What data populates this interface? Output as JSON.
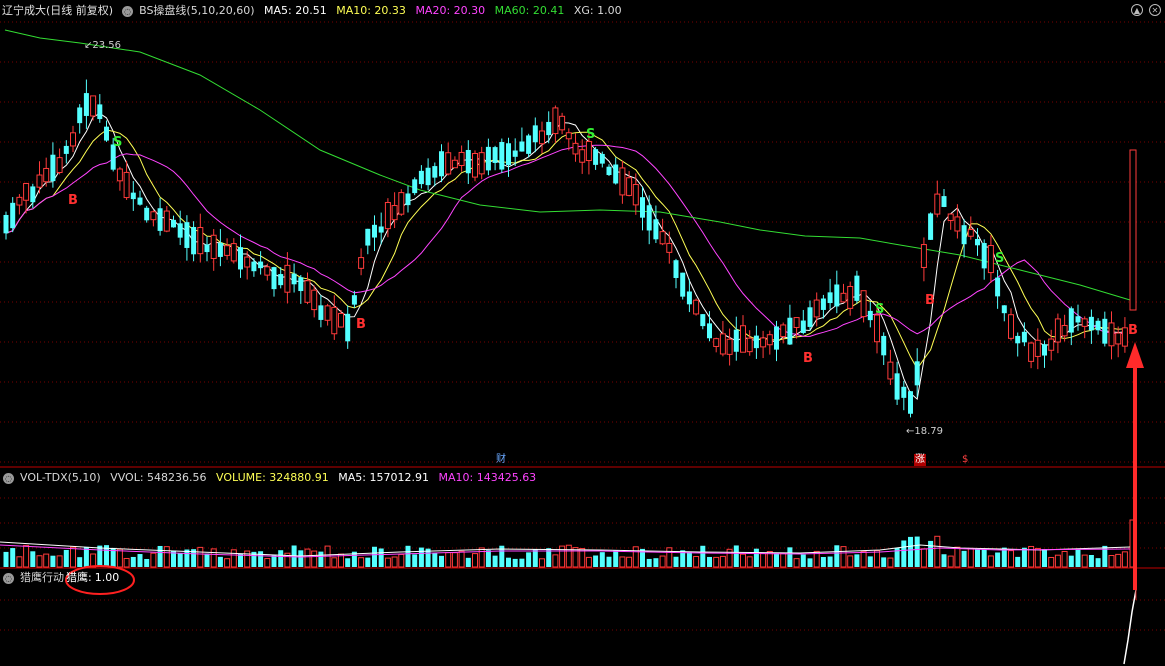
{
  "header_main": {
    "stock": "辽宁成大(日线 前复权)",
    "indicator": "BS操盘线(5,10,20,60)",
    "ma5": "MA5: 20.51",
    "ma10": "MA10: 20.33",
    "ma20": "MA20: 20.30",
    "ma60": "MA60: 20.41",
    "xg": "XG: 1.00"
  },
  "header_vol": {
    "name": "VOL-TDX(5,10)",
    "vvol": "VVOL: 548236.56",
    "volume": "VOLUME: 324880.91",
    "ma5": "MA5: 157012.91",
    "ma10": "MA10: 143425.63"
  },
  "header_hawk": {
    "name": "猎鹰行动",
    "value_label": "猎鹰:",
    "value": "1.00"
  },
  "labels": {
    "high": "23.56",
    "low": "18.79",
    "cai": "财",
    "zhang": "涨",
    "s_dollar": "$",
    "b": "B",
    "s": "S"
  },
  "colors": {
    "up": "#ff3b3b",
    "down": "#54ffff",
    "ma5": "#ffffff",
    "ma10": "#ffff55",
    "ma20": "#ff44ff",
    "ma60": "#33dd33",
    "grid": "#7a0000",
    "signal_b": "#ff3030",
    "signal_s": "#33ee33"
  }
}
